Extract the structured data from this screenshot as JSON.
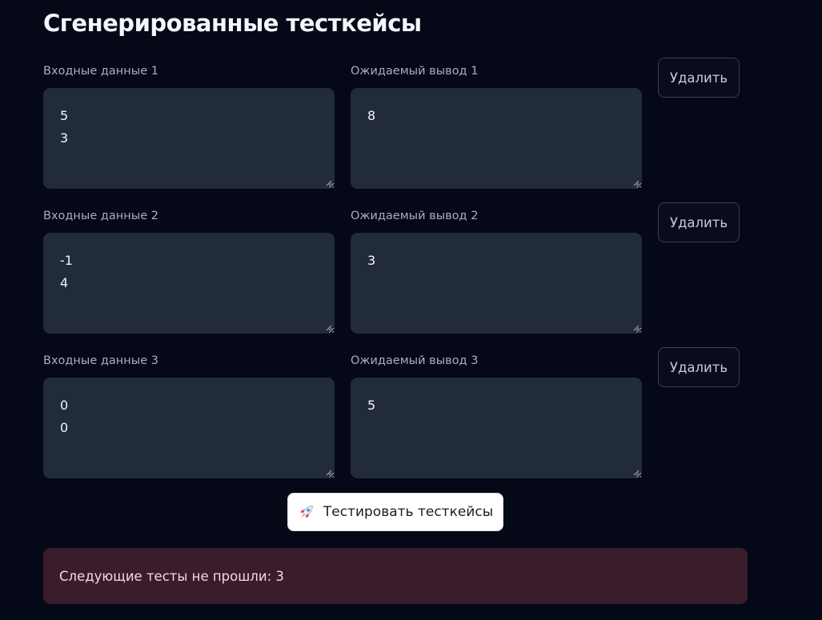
{
  "header": {
    "title": "Сгенерированные тесткейсы"
  },
  "testcases": [
    {
      "input_label": "Входные данные 1",
      "input_value": "5\n3",
      "output_label": "Ожидаемый вывод 1",
      "output_value": "8",
      "delete_label": "Удалить"
    },
    {
      "input_label": "Входные данные 2",
      "input_value": "-1\n4",
      "output_label": "Ожидаемый вывод 2",
      "output_value": "3",
      "delete_label": "Удалить"
    },
    {
      "input_label": "Входные данные 3",
      "input_value": "0\n0",
      "output_label": "Ожидаемый вывод 3",
      "output_value": "5",
      "delete_label": "Удалить"
    }
  ],
  "actions": {
    "test_label": "Тестировать тесткейсы",
    "test_icon": "rocket-icon"
  },
  "result": {
    "message": "Следующие тесты не прошли: 3"
  },
  "colors": {
    "background": "#050817",
    "textarea": "#222b3c",
    "error_background": "#3a1c2a",
    "error_text": "#f5d9df"
  }
}
